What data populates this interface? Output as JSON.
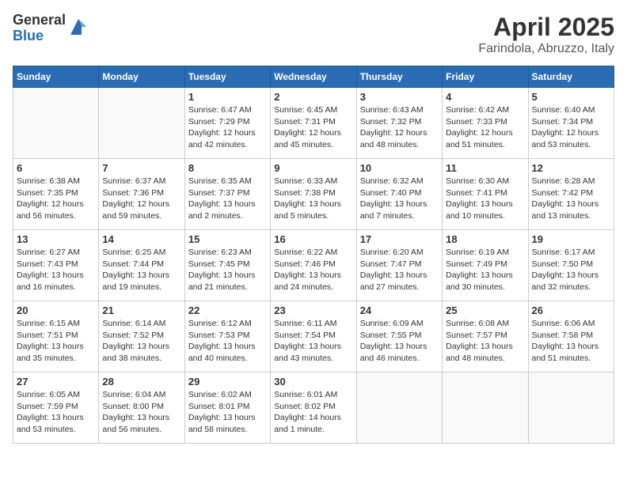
{
  "header": {
    "logo_general": "General",
    "logo_blue": "Blue",
    "month": "April 2025",
    "location": "Farindola, Abruzzo, Italy"
  },
  "weekdays": [
    "Sunday",
    "Monday",
    "Tuesday",
    "Wednesday",
    "Thursday",
    "Friday",
    "Saturday"
  ],
  "weeks": [
    [
      {
        "day": "",
        "info": ""
      },
      {
        "day": "",
        "info": ""
      },
      {
        "day": "1",
        "info": "Sunrise: 6:47 AM\nSunset: 7:29 PM\nDaylight: 12 hours and 42 minutes."
      },
      {
        "day": "2",
        "info": "Sunrise: 6:45 AM\nSunset: 7:31 PM\nDaylight: 12 hours and 45 minutes."
      },
      {
        "day": "3",
        "info": "Sunrise: 6:43 AM\nSunset: 7:32 PM\nDaylight: 12 hours and 48 minutes."
      },
      {
        "day": "4",
        "info": "Sunrise: 6:42 AM\nSunset: 7:33 PM\nDaylight: 12 hours and 51 minutes."
      },
      {
        "day": "5",
        "info": "Sunrise: 6:40 AM\nSunset: 7:34 PM\nDaylight: 12 hours and 53 minutes."
      }
    ],
    [
      {
        "day": "6",
        "info": "Sunrise: 6:38 AM\nSunset: 7:35 PM\nDaylight: 12 hours and 56 minutes."
      },
      {
        "day": "7",
        "info": "Sunrise: 6:37 AM\nSunset: 7:36 PM\nDaylight: 12 hours and 59 minutes."
      },
      {
        "day": "8",
        "info": "Sunrise: 6:35 AM\nSunset: 7:37 PM\nDaylight: 13 hours and 2 minutes."
      },
      {
        "day": "9",
        "info": "Sunrise: 6:33 AM\nSunset: 7:38 PM\nDaylight: 13 hours and 5 minutes."
      },
      {
        "day": "10",
        "info": "Sunrise: 6:32 AM\nSunset: 7:40 PM\nDaylight: 13 hours and 7 minutes."
      },
      {
        "day": "11",
        "info": "Sunrise: 6:30 AM\nSunset: 7:41 PM\nDaylight: 13 hours and 10 minutes."
      },
      {
        "day": "12",
        "info": "Sunrise: 6:28 AM\nSunset: 7:42 PM\nDaylight: 13 hours and 13 minutes."
      }
    ],
    [
      {
        "day": "13",
        "info": "Sunrise: 6:27 AM\nSunset: 7:43 PM\nDaylight: 13 hours and 16 minutes."
      },
      {
        "day": "14",
        "info": "Sunrise: 6:25 AM\nSunset: 7:44 PM\nDaylight: 13 hours and 19 minutes."
      },
      {
        "day": "15",
        "info": "Sunrise: 6:23 AM\nSunset: 7:45 PM\nDaylight: 13 hours and 21 minutes."
      },
      {
        "day": "16",
        "info": "Sunrise: 6:22 AM\nSunset: 7:46 PM\nDaylight: 13 hours and 24 minutes."
      },
      {
        "day": "17",
        "info": "Sunrise: 6:20 AM\nSunset: 7:47 PM\nDaylight: 13 hours and 27 minutes."
      },
      {
        "day": "18",
        "info": "Sunrise: 6:19 AM\nSunset: 7:49 PM\nDaylight: 13 hours and 30 minutes."
      },
      {
        "day": "19",
        "info": "Sunrise: 6:17 AM\nSunset: 7:50 PM\nDaylight: 13 hours and 32 minutes."
      }
    ],
    [
      {
        "day": "20",
        "info": "Sunrise: 6:15 AM\nSunset: 7:51 PM\nDaylight: 13 hours and 35 minutes."
      },
      {
        "day": "21",
        "info": "Sunrise: 6:14 AM\nSunset: 7:52 PM\nDaylight: 13 hours and 38 minutes."
      },
      {
        "day": "22",
        "info": "Sunrise: 6:12 AM\nSunset: 7:53 PM\nDaylight: 13 hours and 40 minutes."
      },
      {
        "day": "23",
        "info": "Sunrise: 6:11 AM\nSunset: 7:54 PM\nDaylight: 13 hours and 43 minutes."
      },
      {
        "day": "24",
        "info": "Sunrise: 6:09 AM\nSunset: 7:55 PM\nDaylight: 13 hours and 46 minutes."
      },
      {
        "day": "25",
        "info": "Sunrise: 6:08 AM\nSunset: 7:57 PM\nDaylight: 13 hours and 48 minutes."
      },
      {
        "day": "26",
        "info": "Sunrise: 6:06 AM\nSunset: 7:58 PM\nDaylight: 13 hours and 51 minutes."
      }
    ],
    [
      {
        "day": "27",
        "info": "Sunrise: 6:05 AM\nSunset: 7:59 PM\nDaylight: 13 hours and 53 minutes."
      },
      {
        "day": "28",
        "info": "Sunrise: 6:04 AM\nSunset: 8:00 PM\nDaylight: 13 hours and 56 minutes."
      },
      {
        "day": "29",
        "info": "Sunrise: 6:02 AM\nSunset: 8:01 PM\nDaylight: 13 hours and 58 minutes."
      },
      {
        "day": "30",
        "info": "Sunrise: 6:01 AM\nSunset: 8:02 PM\nDaylight: 14 hours and 1 minute."
      },
      {
        "day": "",
        "info": ""
      },
      {
        "day": "",
        "info": ""
      },
      {
        "day": "",
        "info": ""
      }
    ]
  ]
}
